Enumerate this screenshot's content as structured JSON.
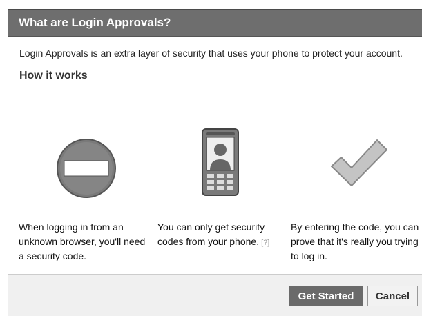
{
  "dialog": {
    "title": "What are Login Approvals?",
    "intro": "Login Approvals is an extra layer of security that uses your phone to protect your account.",
    "subheading": "How it works",
    "steps": [
      {
        "icon": "no-entry-icon",
        "text": "When logging in from an unknown browser, you'll need a security code."
      },
      {
        "icon": "mobile-phone-icon",
        "text": "You can only get security codes from your phone.",
        "help_link": "[?]"
      },
      {
        "icon": "checkmark-icon",
        "text": "By entering the code, you can prove that it's really you trying to log in."
      }
    ],
    "buttons": {
      "primary": "Get Started",
      "secondary": "Cancel"
    }
  },
  "colors": {
    "header_bg": "#6e6e6e",
    "header_text": "#ffffff",
    "primary_button": "#6a6a6a",
    "footer_bg": "#f0f0f0"
  }
}
